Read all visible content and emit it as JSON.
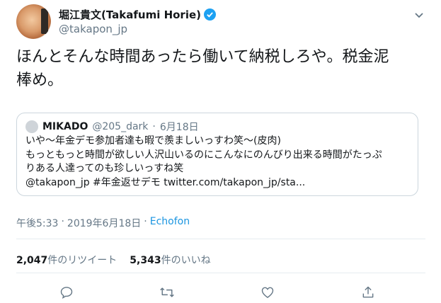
{
  "tweet": {
    "author": {
      "display_name": "堀江貴文(Takafumi Horie)",
      "handle": "@takapon_jp",
      "verified": true
    },
    "text_lines": [
      "ほんとそんな時間あったら働いて納税しろや。税金泥",
      "棒め。"
    ],
    "quoted": {
      "name": "MIKADO",
      "handle": "@205_dark",
      "separator": "·",
      "date": "6月18日",
      "lines": [
        "いや〜年金デモ参加者達も暇で羨ましいっすわ笑〜(皮肉)",
        "もっともっと時間が欲しい人沢山いるのにこんなにのんびり出来る時間がたっぷ",
        "りある人達ってのも珍しいっすね笑",
        "@takapon_jp #年金返せデモ twitter.com/takapon_jp/sta..."
      ]
    },
    "meta": {
      "time": "午後5:33",
      "sep1": "·",
      "date": "2019年6月18日",
      "sep2": "·",
      "app": "Echofon"
    },
    "stats": {
      "retweets_count": "2,047",
      "retweets_label": "件のリツイート",
      "likes_count": "5,343",
      "likes_label": "件のいいね"
    }
  },
  "icons": [
    "verified-badge-icon",
    "chevron-down-icon",
    "reply-icon",
    "retweet-icon",
    "like-icon",
    "share-icon"
  ],
  "colors": {
    "accent": "#1da1f2",
    "link": "#1b95e0",
    "muted": "#657786",
    "border": "#ccd6dd"
  }
}
